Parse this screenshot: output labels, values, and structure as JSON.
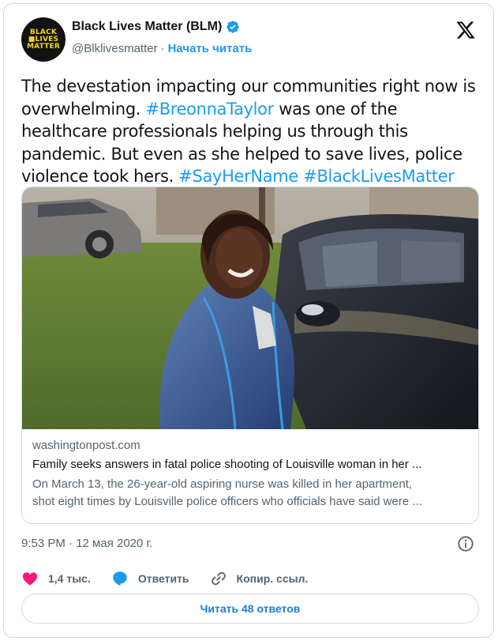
{
  "author": {
    "display_name": "Black Lives Matter (BLM)",
    "handle": "@Blklivesmatter",
    "separator": "·",
    "follow_label": "Начать читать",
    "avatar_logo_lines": [
      "BLACK",
      "■LIVES",
      "MATTER"
    ]
  },
  "tweet": {
    "text_parts": [
      {
        "text": "The devestation impacting our communities right now is overwhelming. ",
        "type": "plain"
      },
      {
        "text": "#BreonnaTaylor",
        "type": "hashtag"
      },
      {
        "text": " was one of the healthcare professionals helping us through this pandemic. But even as she helped to save lives, police violence took hers. ",
        "type": "plain"
      },
      {
        "text": "#SayHerName",
        "type": "hashtag"
      },
      {
        "text": " ",
        "type": "plain"
      },
      {
        "text": "#BlackLivesMatter",
        "type": "hashtag"
      }
    ]
  },
  "link_card": {
    "domain": "washingtonpost.com",
    "headline": "Family seeks answers in fatal police shooting of Louisville woman in her ...",
    "description_line1": "On March 13, the 26-year-old aspiring nurse was killed in her apartment,",
    "description_line2": "shot eight times by Louisville police officers who officials have said were ..."
  },
  "timestamp": "9:53 PM · 12 мая 2020 г.",
  "actions": {
    "likes": "1,4 тыс.",
    "reply_label": "Ответить",
    "copy_link_label": "Копир. ссыл."
  },
  "read_replies_label": "Читать 48 ответов",
  "colors": {
    "accent": "#1d9bf0",
    "like": "#f91880",
    "border": "#cfd9de",
    "secondary_text": "#536471"
  },
  "icons": [
    "verified-badge-icon",
    "x-logo-icon",
    "info-icon",
    "heart-icon",
    "reply-bubble-icon",
    "link-icon"
  ]
}
